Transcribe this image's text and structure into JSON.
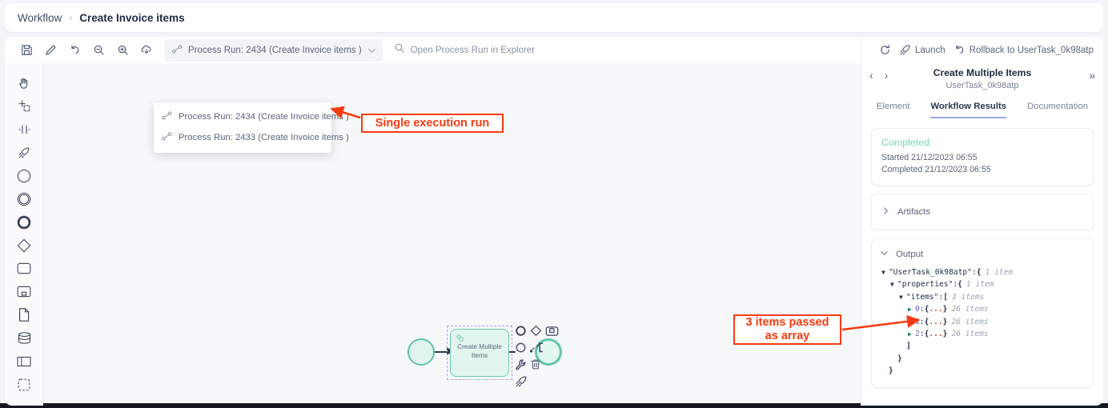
{
  "breadcrumb": {
    "root": "Workflow",
    "separator": "›",
    "current": "Create Invoice items"
  },
  "toolbar": {
    "icons": [
      {
        "name": "save-icon",
        "title": "Save"
      },
      {
        "name": "edit-pencil-icon",
        "title": "Edit"
      },
      {
        "name": "undo-icon",
        "title": "Undo"
      },
      {
        "name": "zoom-out-icon",
        "title": "Zoom out"
      },
      {
        "name": "zoom-in-icon",
        "title": "Zoom in"
      },
      {
        "name": "cloud-download-icon",
        "title": "Download"
      }
    ],
    "run_selector": {
      "label": "Process Run: 2434 (Create Invoice items )",
      "icon": "process-run-icon",
      "chevron": "chevron-down-icon"
    },
    "explorer_link": {
      "label": "Open Process Run in Explorer",
      "icon": "search-icon"
    }
  },
  "dropdown": {
    "open": true,
    "items": [
      {
        "label": "Process Run: 2434 (Create Invoice items )",
        "selected": true
      },
      {
        "label": "Process Run: 2433 (Create Invoice items )",
        "selected": false
      }
    ]
  },
  "left_rail": {
    "items": [
      {
        "name": "hand-pan-icon"
      },
      {
        "name": "lasso-select-icon"
      },
      {
        "name": "align-center-icon"
      },
      {
        "name": "launch-rocket-icon"
      },
      {
        "name": "start-event-icon"
      },
      {
        "name": "intermediate-event-icon"
      },
      {
        "name": "end-event-icon"
      },
      {
        "name": "gateway-diamond-icon"
      },
      {
        "name": "task-rectangle-icon"
      },
      {
        "name": "subprocess-icon"
      },
      {
        "name": "data-object-icon"
      },
      {
        "name": "data-store-icon"
      },
      {
        "name": "pool-icon"
      },
      {
        "name": "group-icon"
      }
    ]
  },
  "canvas": {
    "node": {
      "label_line1": "Create Multiple",
      "label_line2": "Items",
      "gear_icon": "gear-icon",
      "selected": true
    },
    "start_event": "start-event-node",
    "end_event": "end-event-node",
    "context_palette": [
      [
        "circle-event-icon",
        "diamond-gateway-icon",
        "subprocess-icon"
      ],
      [
        "circle-outline-icon",
        "connect-icon"
      ],
      [
        "wrench-icon",
        "trash-icon"
      ],
      [
        "rocket-icon"
      ]
    ]
  },
  "annotations": [
    {
      "id": "single-run",
      "text": "Single execution run"
    },
    {
      "id": "items-array",
      "line1": "3 items passed",
      "line2": "as array"
    }
  ],
  "right_panel": {
    "actions": [
      {
        "name": "refresh-icon",
        "label": ""
      },
      {
        "name": "launch-rocket-icon",
        "label": "Launch"
      },
      {
        "name": "rollback-icon",
        "label": "Rollback to UserTask_0k98atp"
      }
    ],
    "nav": {
      "prev": "‹",
      "next": "›",
      "collapse": "»"
    },
    "title": "Create Multiple Items",
    "subtitle": "UserTask_0k98atp",
    "tabs": [
      {
        "label": "Element",
        "active": false
      },
      {
        "label": "Workflow Results",
        "active": true
      },
      {
        "label": "Documentation",
        "active": false
      }
    ],
    "status": {
      "state": "Completed",
      "started": "Started 21/12/2023 06:55",
      "completed": "Completed 21/12/2023 06:55",
      "color": "#79d6b4"
    },
    "artifacts": {
      "label": "Artifacts",
      "expanded": false,
      "chevron": "chevron-right-icon"
    },
    "output": {
      "label": "Output",
      "expanded": true,
      "chevron": "chevron-down-icon",
      "tree": [
        {
          "indent": 0,
          "caret": "open",
          "key": "\"UserTask_0k98atp\"",
          "colon": " : ",
          "brace": "{",
          "count": "1 item"
        },
        {
          "indent": 1,
          "caret": "open",
          "key": "\"properties\"",
          "colon": " : ",
          "brace": "{",
          "count": "1 item"
        },
        {
          "indent": 2,
          "caret": "open",
          "key": "\"items\"",
          "colon": " : ",
          "brace": "[",
          "count": "3 items"
        },
        {
          "indent": 3,
          "caret": "closed",
          "key": "0",
          "colon": " : ",
          "brace": "{...}",
          "count": "26 items",
          "is_index": true
        },
        {
          "indent": 3,
          "caret": "closed",
          "key": "1",
          "colon": " : ",
          "brace": "{...}",
          "count": "26 items",
          "is_index": true
        },
        {
          "indent": 3,
          "caret": "closed",
          "key": "2",
          "colon": " : ",
          "brace": "{...}",
          "count": "26 items",
          "is_index": true
        },
        {
          "indent": 2,
          "caret": "none",
          "key": "",
          "colon": "",
          "brace": "]",
          "count": ""
        },
        {
          "indent": 1,
          "caret": "none",
          "key": "",
          "colon": "",
          "brace": "}",
          "count": ""
        },
        {
          "indent": 0,
          "caret": "none",
          "key": "",
          "colon": "",
          "brace": "}",
          "count": ""
        }
      ]
    }
  }
}
